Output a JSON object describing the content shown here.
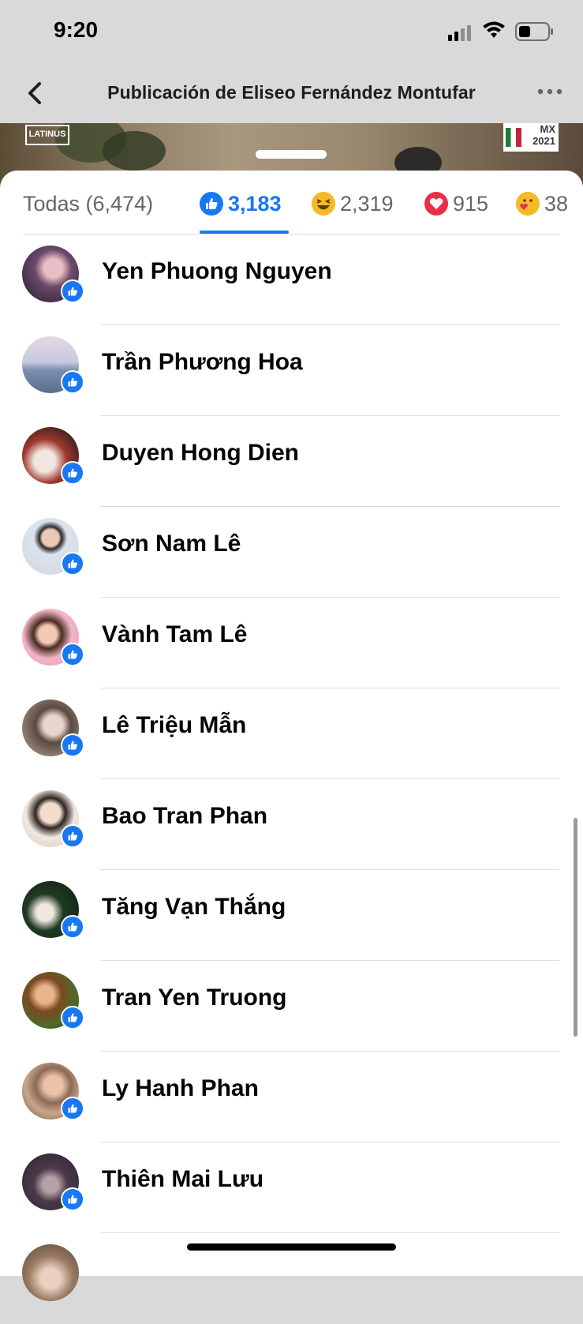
{
  "status_bar": {
    "time": "9:20"
  },
  "header": {
    "title": "Publicación de Eliseo Fernández Montufar"
  },
  "post_image": {
    "latinus_label": "LATINUS",
    "mx_badge_line1": "MX",
    "mx_badge_line2": "2021"
  },
  "tabs": {
    "all": "Todas (6,474)",
    "like": "3,183",
    "haha": "2,319",
    "love": "915",
    "care": "38",
    "active": "like"
  },
  "colors": {
    "accent": "#1877f2",
    "love": "#e8304a",
    "emoji_yellow": "#f7b928"
  },
  "people": [
    {
      "name": "Yen Phuong Nguyen",
      "reaction": "like-icon"
    },
    {
      "name": "Trần Phương Hoa",
      "reaction": "like-icon"
    },
    {
      "name": "Duyen Hong Dien",
      "reaction": "like-icon"
    },
    {
      "name": "Sơn Nam Lê",
      "reaction": "like-icon"
    },
    {
      "name": "Vành Tam Lê",
      "reaction": "like-icon"
    },
    {
      "name": "Lê Triệu Mẫn",
      "reaction": "like-icon"
    },
    {
      "name": "Bao Tran Phan",
      "reaction": "like-icon"
    },
    {
      "name": "Tăng Vạn Thắng",
      "reaction": "like-icon"
    },
    {
      "name": "Tran Yen Truong",
      "reaction": "like-icon"
    },
    {
      "name": "Ly Hanh Phan",
      "reaction": "like-icon"
    },
    {
      "name": "Thiên Mai Lưu",
      "reaction": "like-icon"
    }
  ]
}
